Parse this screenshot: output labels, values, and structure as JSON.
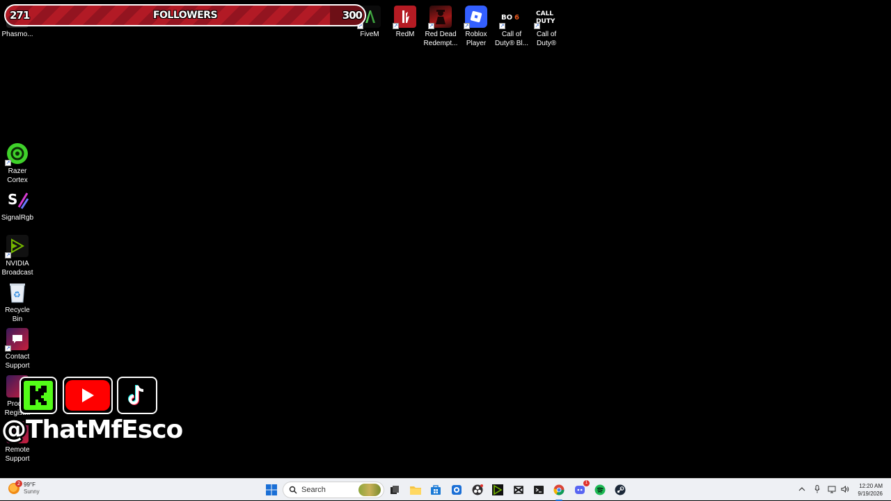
{
  "overlay": {
    "followers": {
      "title": "FOLLOWERS",
      "current": "271",
      "goal": "300",
      "progress": 0.903
    },
    "handle": "@ThatMfEsco",
    "social_icons": [
      "kick-logo",
      "youtube-logo",
      "tiktok-logo"
    ]
  },
  "desktop": {
    "icons": [
      {
        "id": "phasmophobia",
        "label": "Phasmo...",
        "icon": "phasmophobia-icon"
      },
      {
        "id": "fivem",
        "label": "FiveM",
        "icon": "fivem-icon"
      },
      {
        "id": "redm",
        "label": "RedM",
        "icon": "redm-icon"
      },
      {
        "id": "rdr",
        "label": "Red Dead\nRedempt...",
        "icon": "red-dead-redemption-icon"
      },
      {
        "id": "roblox",
        "label": "Roblox\nPlayer",
        "icon": "roblox-icon"
      },
      {
        "id": "codbo6",
        "label": "Call of\nDuty® Bl...",
        "icon": "call-of-duty-bo6-icon"
      },
      {
        "id": "cod",
        "label": "Call of\nDuty®",
        "icon": "call-of-duty-icon"
      },
      {
        "id": "razer",
        "label": "Razer\nCortex",
        "icon": "razer-cortex-icon"
      },
      {
        "id": "signalrgb",
        "label": "SignalRgb",
        "icon": "signalrgb-icon"
      },
      {
        "id": "nvidia",
        "label": "NVIDIA\nBroadcast",
        "icon": "nvidia-broadcast-icon"
      },
      {
        "id": "recycle",
        "label": "Recycle Bin",
        "icon": "recycle-bin-icon"
      },
      {
        "id": "contact",
        "label": "Contact\nSupport",
        "icon": "contact-support-icon"
      },
      {
        "id": "product",
        "label": "Prod...\nRegist...",
        "icon": "product-registration-icon"
      },
      {
        "id": "remote",
        "label": "Remote\nSupport",
        "icon": "remote-support-icon"
      }
    ]
  },
  "taskbar": {
    "weather": {
      "temp": "99°F",
      "condition": "Sunny",
      "badge": "2"
    },
    "search_placeholder": "Search",
    "apps": [
      "windows-start-icon",
      "search-icon",
      "task-view-icon",
      "file-explorer-icon",
      "microsoft-store-icon",
      "edge-icon",
      "obs-icon",
      "nvidia-icon",
      "capcut-icon",
      "terminal-icon",
      "chrome-icon",
      "discord-icon",
      "spotify-icon",
      "steam-icon"
    ],
    "discord_badge": "1",
    "clock": {
      "time": "12:20 AM",
      "date": "9/19/2026"
    },
    "colors": {
      "accent": "#1a6fd6",
      "taskbar_bg": "#eef0f4"
    }
  }
}
